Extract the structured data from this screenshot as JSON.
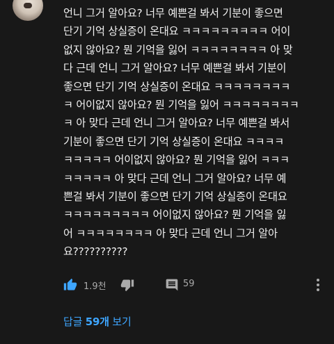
{
  "comment": {
    "lines": [
      "언니 그거 알아요? 너무 예쁜걸 봐서 기분이 좋으면",
      "단기 기억 상실증이 온대요 ㅋㅋㅋㅋㅋㅋㅋㅋㅋ 어이",
      "없지 않아요? 뭔 기억을 잃어 ㅋㅋㅋㅋㅋㅋㅋㅋ 아 맞",
      "다 근데 언니 그거 알아요? 너무 예쁜걸 봐서 기분이",
      "좋으면 단기 기억 상실증이 온대요 ㅋㅋㅋㅋㅋㅋㅋㅋ",
      "ㅋ 어이없지 않아요? 뭔 기억을 잃어 ㅋㅋㅋㅋㅋㅋㅋㅋ",
      "ㅋ 아 맞다 근데 언니 그거 알아요? 너무 예쁜걸 봐서",
      "기분이 좋으면 단기 기억 상실증이 온대요 ㅋㅋㅋㅋ",
      "ㅋㅋㅋㅋㅋ 어이없지 않아요? 뭔 기억을 잃어 ㅋㅋㅋ",
      "ㅋㅋㅋㅋㅋ 아 맞다 근데 언니 그거 알아요? 너무 예",
      "쁜걸 봐서 기분이 좋으면 단기 기억 상실증이 온대요",
      "ㅋㅋㅋㅋㅋㅋㅋㅋㅋ 어이없지 않아요? 뭔 기억을 잃",
      "어 ㅋㅋㅋㅋㅋㅋㅋㅋ 아 맞다 근데  언니 그거 알아",
      "요??????????"
    ]
  },
  "actions": {
    "like_count": "1.9천",
    "reply_count": "59",
    "like_icon": "thumbs-up-icon",
    "dislike_icon": "thumbs-down-icon",
    "reply_icon": "comment-icon",
    "more_icon": "more-vertical-icon"
  },
  "replies": {
    "prefix": "답글 ",
    "count": "59개",
    "suffix": " 보기"
  },
  "colors": {
    "background": "#181818",
    "text": "#f1f1f1",
    "secondary": "#aaaaaa",
    "link": "#3ea6ff",
    "like_active": "#3ea6ff"
  }
}
